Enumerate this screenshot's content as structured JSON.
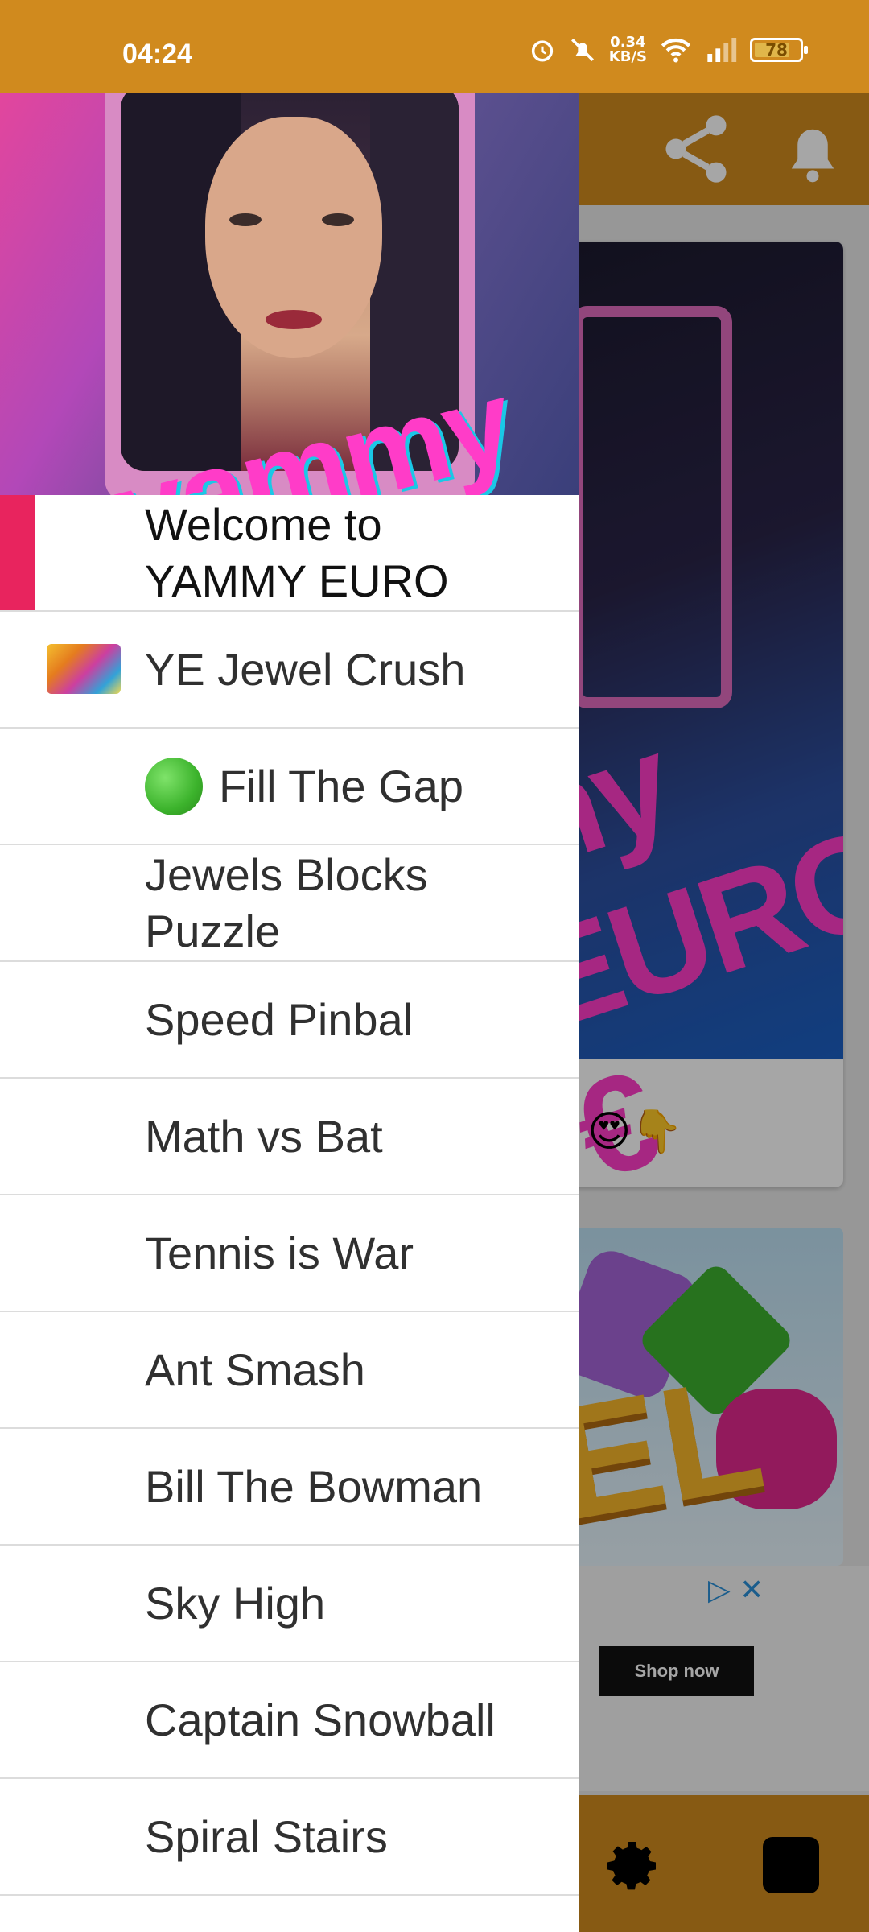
{
  "status_bar": {
    "time": "04:24",
    "speed_value": "0.34",
    "speed_unit": "KB/S",
    "battery": "78",
    "icons": [
      "alarm-icon",
      "mute-bell-icon",
      "wifi-icon",
      "signal-icon",
      "battery-icon"
    ]
  },
  "app_header": {
    "icons": [
      "share-icon",
      "bell-icon"
    ]
  },
  "drawer": {
    "header_logo": "yammy EURO",
    "items": [
      {
        "label": "Welcome to YAMMY EURO",
        "active": true
      },
      {
        "label": "YE Jewel Crush",
        "icon": "jewel-crush-thumbnail"
      },
      {
        "label": "Fill The Gap",
        "icon": "green-circle-icon"
      },
      {
        "label": "Jewels Blocks Puzzle"
      },
      {
        "label": "Speed Pinbal"
      },
      {
        "label": "Math vs Bat"
      },
      {
        "label": "Tennis is War"
      },
      {
        "label": "Ant Smash"
      },
      {
        "label": "Bill The Bowman"
      },
      {
        "label": "Sky High"
      },
      {
        "label": "Captain Snowball"
      },
      {
        "label": "Spiral Stairs"
      }
    ]
  },
  "background": {
    "card_logo": "my EURO €",
    "card_emojis": "😍👇",
    "game_card_text": "EL",
    "ad_button": "Shop now"
  },
  "bottom_bar": {
    "icons": [
      "gear-icon",
      "stop-icon"
    ]
  },
  "colors": {
    "primary": "#d08a1e",
    "accent": "#e8245e"
  }
}
